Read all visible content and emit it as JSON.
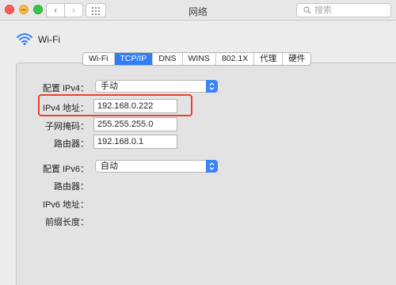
{
  "window": {
    "title": "网络",
    "search_placeholder": "搜索"
  },
  "header": {
    "interface_label": "Wi-Fi"
  },
  "tabs": [
    {
      "label": "Wi-Fi",
      "active": false
    },
    {
      "label": "TCP/IP",
      "active": true
    },
    {
      "label": "DNS",
      "active": false
    },
    {
      "label": "WINS",
      "active": false
    },
    {
      "label": "802.1X",
      "active": false
    },
    {
      "label": "代理",
      "active": false
    },
    {
      "label": "硬件",
      "active": false
    }
  ],
  "ipv4": {
    "config_label": "配置 IPv4：",
    "config_value": "手动",
    "address_label": "IPv4 地址：",
    "address_value": "192.168.0.222",
    "subnet_label": "子网掩码：",
    "subnet_value": "255.255.255.0",
    "router_label": "路由器：",
    "router_value": "192.168.0.1"
  },
  "ipv6": {
    "config_label": "配置 IPv6：",
    "config_value": "自动",
    "router_label": "路由器：",
    "address_label": "IPv6 地址：",
    "prefix_label": "前缀长度："
  },
  "colors": {
    "accent": "#2f7cf6",
    "highlight": "#e9412e"
  }
}
